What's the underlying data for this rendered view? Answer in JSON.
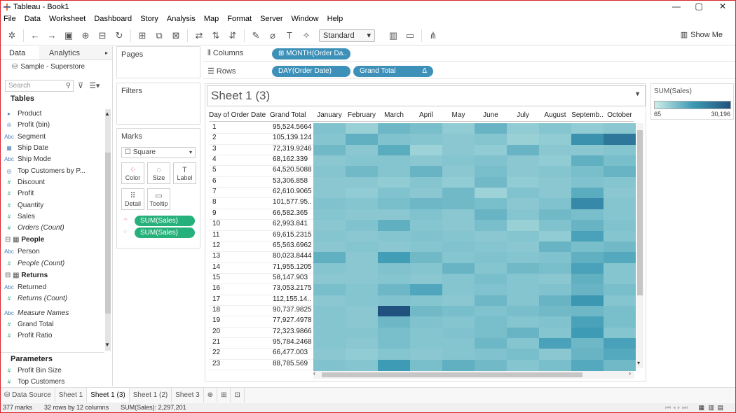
{
  "window": {
    "title": "Tableau - Book1",
    "controls": [
      "—",
      "▢",
      "✕"
    ]
  },
  "menu": {
    "items": [
      "File",
      "Data",
      "Worksheet",
      "Dashboard",
      "Story",
      "Analysis",
      "Map",
      "Format",
      "Server",
      "Window",
      "Help"
    ]
  },
  "toolbar": {
    "fit_select": "Standard",
    "show_me_label": "Show Me"
  },
  "datapane": {
    "tab_data": "Data",
    "tab_analytics": "Analytics",
    "datasource": "Sample - Superstore",
    "search_placeholder": "Search",
    "tables_header": "Tables",
    "fields": [
      {
        "type": "dim",
        "icon": "▸",
        "label": "Product",
        "italic": false
      },
      {
        "type": "dim",
        "icon": "ılı",
        "label": "Profit (bin)",
        "italic": false
      },
      {
        "type": "dim",
        "icon": "Abc",
        "label": "Segment",
        "italic": false
      },
      {
        "type": "dim",
        "icon": "▦",
        "label": "Ship Date",
        "italic": false
      },
      {
        "type": "dim",
        "icon": "Abc",
        "label": "Ship Mode",
        "italic": false
      },
      {
        "type": "dim",
        "icon": "◎",
        "label": "Top Customers by P...",
        "italic": false
      },
      {
        "type": "mea",
        "icon": "#",
        "label": "Discount",
        "italic": false
      },
      {
        "type": "mea",
        "icon": "#",
        "label": "Profit",
        "italic": false
      },
      {
        "type": "mea",
        "icon": "#",
        "label": "Quantity",
        "italic": false
      },
      {
        "type": "mea",
        "icon": "#",
        "label": "Sales",
        "italic": false
      },
      {
        "type": "mea",
        "icon": "#",
        "label": "Orders (Count)",
        "italic": true
      }
    ],
    "people_header": "People",
    "people_fields": [
      {
        "type": "dim",
        "icon": "Abc",
        "label": "Person",
        "italic": false
      },
      {
        "type": "mea",
        "icon": "#",
        "label": "People (Count)",
        "italic": true
      }
    ],
    "returns_header": "Returns",
    "returns_fields": [
      {
        "type": "dim",
        "icon": "Abc",
        "label": "Returned",
        "italic": false
      },
      {
        "type": "mea",
        "icon": "#",
        "label": "Returns (Count)",
        "italic": true
      }
    ],
    "extra_fields": [
      {
        "type": "dim",
        "icon": "Abc",
        "label": "Measure Names",
        "italic": true
      },
      {
        "type": "mea",
        "icon": "#",
        "label": "Grand Total",
        "italic": false
      },
      {
        "type": "mea",
        "icon": "#",
        "label": "Profit Ratio",
        "italic": false
      }
    ],
    "parameters_header": "Parameters",
    "parameters": [
      {
        "type": "mea",
        "icon": "#",
        "label": "Profit Bin Size",
        "italic": false
      },
      {
        "type": "mea",
        "icon": "#",
        "label": "Top Customers",
        "italic": false
      }
    ]
  },
  "cards": {
    "pages": "Pages",
    "filters": "Filters",
    "marks": "Marks",
    "mark_type": "Square",
    "buttons": [
      {
        "icon": "⁘",
        "label": "Color"
      },
      {
        "icon": "◌",
        "label": "Size"
      },
      {
        "icon": "T",
        "label": "Label"
      },
      {
        "icon": "⠿",
        "label": "Detail"
      },
      {
        "icon": "▭",
        "label": "Tooltip"
      }
    ],
    "mark_pills": [
      "SUM(Sales)",
      "SUM(Sales)"
    ]
  },
  "shelves": {
    "columns_label": "Columns",
    "rows_label": "Rows",
    "columns_pill": "MONTH(Order Da..",
    "rows_pills": [
      "DAY(Order Date)",
      "Grand Total"
    ]
  },
  "view": {
    "title": "Sheet 1 (3)",
    "headers": [
      "Day of Order Date",
      "Grand Total",
      "January",
      "February",
      "March",
      "April",
      "May",
      "June",
      "July",
      "August",
      "Septemb..",
      "October"
    ]
  },
  "legend": {
    "title": "SUM(Sales)",
    "min": "65",
    "max": "30,196"
  },
  "colors": {
    "scale_low": "#cdeee9",
    "scale_mid": "#3d9bb5",
    "scale_high": "#21527f",
    "pill_dimension": "#3d91b8",
    "pill_measure": "#26b07a",
    "frame": "#d9222a"
  },
  "table": {
    "rows": [
      {
        "day": "1",
        "total": "95,524.5664",
        "levels": [
          0.32,
          0.22,
          0.4,
          0.35,
          0.25,
          0.42,
          0.25,
          0.3,
          0.25,
          0.28
        ]
      },
      {
        "day": "2",
        "total": "105,139.124",
        "levels": [
          0.3,
          0.45,
          0.32,
          0.3,
          0.28,
          0.3,
          0.22,
          0.25,
          0.65,
          0.8
        ]
      },
      {
        "day": "3",
        "total": "72,319.9246",
        "levels": [
          0.38,
          0.28,
          0.48,
          0.2,
          0.28,
          0.25,
          0.42,
          0.28,
          0.28,
          0.3
        ]
      },
      {
        "day": "4",
        "total": "68,162.339",
        "levels": [
          0.28,
          0.3,
          0.3,
          0.28,
          0.3,
          0.32,
          0.28,
          0.25,
          0.45,
          0.35
        ]
      },
      {
        "day": "5",
        "total": "64,520.5088",
        "levels": [
          0.3,
          0.38,
          0.3,
          0.42,
          0.28,
          0.35,
          0.28,
          0.3,
          0.35,
          0.42
        ]
      },
      {
        "day": "6",
        "total": "53,306.858",
        "levels": [
          0.28,
          0.28,
          0.25,
          0.3,
          0.25,
          0.38,
          0.25,
          0.28,
          0.32,
          0.3
        ]
      },
      {
        "day": "7",
        "total": "62,610.9065",
        "levels": [
          0.28,
          0.25,
          0.32,
          0.28,
          0.38,
          0.2,
          0.32,
          0.28,
          0.48,
          0.28
        ]
      },
      {
        "day": "8",
        "total": "101,577.95..",
        "levels": [
          0.32,
          0.3,
          0.35,
          0.4,
          0.38,
          0.35,
          0.28,
          0.32,
          0.7,
          0.3
        ]
      },
      {
        "day": "9",
        "total": "66,582.365",
        "levels": [
          0.3,
          0.28,
          0.28,
          0.32,
          0.28,
          0.42,
          0.3,
          0.38,
          0.35,
          0.3
        ]
      },
      {
        "day": "10",
        "total": "62,993.841",
        "levels": [
          0.28,
          0.32,
          0.45,
          0.3,
          0.28,
          0.35,
          0.22,
          0.32,
          0.42,
          0.32
        ]
      },
      {
        "day": "11",
        "total": "69,615.2315",
        "levels": [
          0.3,
          0.28,
          0.3,
          0.32,
          0.3,
          0.28,
          0.3,
          0.25,
          0.55,
          0.3
        ]
      },
      {
        "day": "12",
        "total": "65,563.6962",
        "levels": [
          0.28,
          0.3,
          0.28,
          0.3,
          0.32,
          0.3,
          0.28,
          0.42,
          0.35,
          0.38
        ]
      },
      {
        "day": "13",
        "total": "80,023.8444",
        "levels": [
          0.45,
          0.28,
          0.58,
          0.38,
          0.3,
          0.32,
          0.3,
          0.32,
          0.45,
          0.5
        ]
      },
      {
        "day": "14",
        "total": "71,955.1205",
        "levels": [
          0.3,
          0.28,
          0.32,
          0.3,
          0.42,
          0.3,
          0.38,
          0.35,
          0.55,
          0.3
        ]
      },
      {
        "day": "15",
        "total": "58,147.903",
        "levels": [
          0.28,
          0.28,
          0.3,
          0.28,
          0.3,
          0.35,
          0.3,
          0.28,
          0.45,
          0.3
        ]
      },
      {
        "day": "16",
        "total": "73,053.2175",
        "levels": [
          0.35,
          0.3,
          0.4,
          0.52,
          0.3,
          0.32,
          0.3,
          0.32,
          0.42,
          0.35
        ]
      },
      {
        "day": "17",
        "total": "112,155.14..",
        "levels": [
          0.28,
          0.3,
          0.32,
          0.3,
          0.28,
          0.4,
          0.3,
          0.42,
          0.62,
          0.3
        ]
      },
      {
        "day": "18",
        "total": "90,737.9825",
        "levels": [
          0.3,
          0.28,
          1.0,
          0.38,
          0.35,
          0.32,
          0.35,
          0.38,
          0.4,
          0.35
        ]
      },
      {
        "day": "19",
        "total": "77,927.4978",
        "levels": [
          0.3,
          0.28,
          0.4,
          0.32,
          0.3,
          0.35,
          0.3,
          0.32,
          0.55,
          0.35
        ]
      },
      {
        "day": "20",
        "total": "72,323.9866",
        "levels": [
          0.3,
          0.3,
          0.35,
          0.3,
          0.32,
          0.35,
          0.42,
          0.3,
          0.6,
          0.3
        ]
      },
      {
        "day": "21",
        "total": "95,784.2468",
        "levels": [
          0.3,
          0.28,
          0.35,
          0.3,
          0.3,
          0.4,
          0.3,
          0.55,
          0.4,
          0.55
        ]
      },
      {
        "day": "22",
        "total": "66,477.003",
        "levels": [
          0.28,
          0.25,
          0.3,
          0.28,
          0.3,
          0.32,
          0.35,
          0.28,
          0.42,
          0.5
        ]
      },
      {
        "day": "23",
        "total": "88,785.569",
        "levels": [
          0.32,
          0.3,
          0.6,
          0.35,
          0.45,
          0.38,
          0.3,
          0.35,
          0.5,
          0.38
        ]
      }
    ]
  },
  "sheet_tabs": {
    "data_source": "Data Source",
    "tabs": [
      "Sheet 1",
      "Sheet 1 (3)",
      "Sheet 1 (2)",
      "Sheet 3"
    ],
    "active_index": 1
  },
  "status": {
    "marks": "377 marks",
    "dims": "32 rows by 12 columns",
    "sum": "SUM(Sales): 2,297,201"
  }
}
